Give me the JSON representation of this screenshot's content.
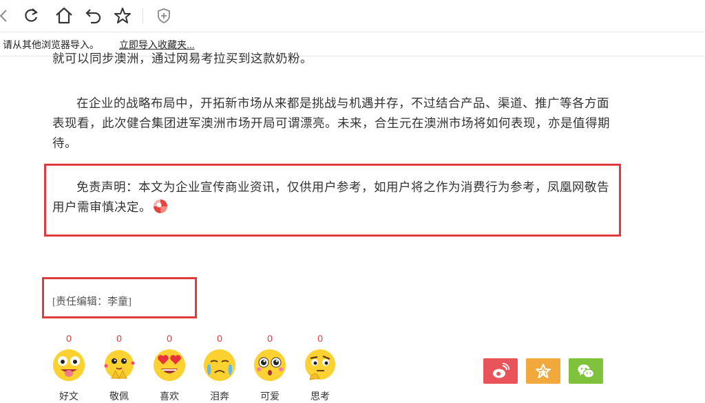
{
  "browser": {
    "icons": [
      "back-icon",
      "refresh-icon",
      "home-icon",
      "undo-icon",
      "star-icon",
      "shield-plus-icon"
    ]
  },
  "favorites_bar": {
    "message": "请从其他浏览器导入。",
    "link": "立即导入收藏夹..."
  },
  "article": {
    "cut_line": "就可以同步澳洲，通过网易考拉买到这款奶粉。",
    "paragraph": "在企业的战略布局中，开拓新市场从来都是挑战与机遇并存，不过结合产品、渠道、推广等各方面表现看，此次健合集团进军澳洲市场开局可谓漂亮。未来，合生元在澳洲市场将如何表现，亦是值得期待。",
    "disclaimer": "免责声明：本文为企业宣传商业资讯，仅供用户参考，如用户将之作为消费行为参考，凤凰网敬告用户需审慎决定。",
    "editor": "[责任编辑：李童]"
  },
  "moods": [
    {
      "count": "0",
      "label": "好文",
      "icon": "tongue-emoji-icon"
    },
    {
      "count": "0",
      "label": "敬佩",
      "icon": "admire-emoji-icon"
    },
    {
      "count": "0",
      "label": "喜欢",
      "icon": "heart-eyes-emoji-icon"
    },
    {
      "count": "0",
      "label": "泪奔",
      "icon": "crying-emoji-icon"
    },
    {
      "count": "0",
      "label": "可爱",
      "icon": "cute-emoji-icon"
    },
    {
      "count": "0",
      "label": "思考",
      "icon": "thinking-emoji-icon"
    }
  ],
  "share": [
    {
      "icon": "weibo-icon",
      "color": "#e8545a"
    },
    {
      "icon": "favorite-star-icon",
      "color": "#f2a93b"
    },
    {
      "icon": "wechat-icon",
      "color": "#7fc23b"
    }
  ],
  "colors": {
    "highlight_box": "#e03a3a",
    "count": "#e03a3a"
  }
}
